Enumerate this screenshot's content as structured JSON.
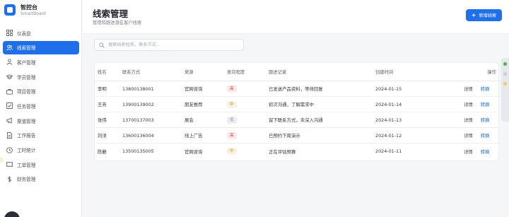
{
  "brand": {
    "name": "智控台",
    "subtitle": "SmartBoard"
  },
  "sidebar": {
    "items": [
      {
        "label": "仪表盘",
        "icon": "dashboard-icon",
        "active": false
      },
      {
        "label": "线索管理",
        "icon": "users-icon",
        "active": true
      },
      {
        "label": "客户管理",
        "icon": "user-icon",
        "active": false
      },
      {
        "label": "学员管理",
        "icon": "graduation-cap-icon",
        "active": false
      },
      {
        "label": "项目管理",
        "icon": "briefcase-icon",
        "active": false
      },
      {
        "label": "任务管理",
        "icon": "checklist-icon",
        "active": false
      },
      {
        "label": "渠道管理",
        "icon": "megaphone-icon",
        "active": false
      },
      {
        "label": "工作报告",
        "icon": "document-icon",
        "active": false
      },
      {
        "label": "工时统计",
        "icon": "clock-icon",
        "active": false
      },
      {
        "label": "工单管理",
        "icon": "ticket-icon",
        "active": false
      },
      {
        "label": "财务管理",
        "icon": "dollar-icon",
        "active": false
      }
    ]
  },
  "header": {
    "title": "线索管理",
    "subtitle": "管理和跟进潜在客户线索",
    "add_button": "新增线索"
  },
  "search": {
    "placeholder": "搜索线索姓名、联系方式...",
    "value": ""
  },
  "table": {
    "columns": [
      "姓名",
      "联系方式",
      "来源",
      "意向程度",
      "跟进记录",
      "创建时间",
      "操作"
    ],
    "rows": [
      {
        "name": "李明",
        "phone": "13800138001",
        "source": "官网咨询",
        "intent": "高",
        "intent_level": "high",
        "follow": "已发送产品资料，等待回复",
        "created": "2024-01-15",
        "detail": "详情",
        "convert": "转换"
      },
      {
        "name": "王芳",
        "phone": "13900139002",
        "source": "朋友推荐",
        "intent": "中",
        "intent_level": "mid",
        "follow": "初次沟通，了解需求中",
        "created": "2024-01-14",
        "detail": "详情",
        "convert": "转换"
      },
      {
        "name": "张伟",
        "phone": "13700137003",
        "source": "展会",
        "intent": "低",
        "intent_level": "low",
        "follow": "留下联系方式，未深入沟通",
        "created": "2024-01-13",
        "detail": "详情",
        "convert": "转换"
      },
      {
        "name": "刘洋",
        "phone": "13600136004",
        "source": "线上广告",
        "intent": "高",
        "intent_level": "high",
        "follow": "已预约下周演示",
        "created": "2024-01-12",
        "detail": "详情",
        "convert": "转换"
      },
      {
        "name": "陈静",
        "phone": "13500135005",
        "source": "官网咨询",
        "intent": "中",
        "intent_level": "mid",
        "follow": "正在评估预算",
        "created": "2024-01-11",
        "detail": "详情",
        "convert": "转换"
      }
    ]
  },
  "colors": {
    "accent": "#1f6feb",
    "high": "#d9363e",
    "mid": "#d68a1a",
    "low": "#8a919c"
  }
}
